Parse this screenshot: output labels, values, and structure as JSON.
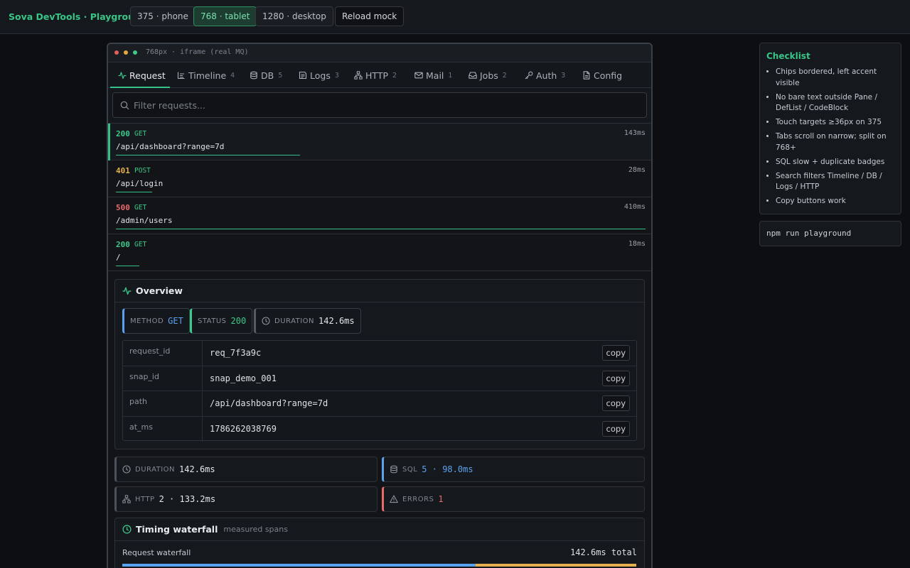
{
  "app": {
    "title": "Sova DevTools · Playground"
  },
  "viewports": [
    {
      "label": "375 · phone",
      "active": false
    },
    {
      "label": "768 · tablet",
      "active": true
    },
    {
      "label": "1280 · desktop",
      "active": false
    }
  ],
  "reload_label": "Reload mock",
  "device": {
    "label": "768px · iframe (real MQ)"
  },
  "tabs": [
    {
      "label": "Request",
      "count": "",
      "icon": "activity-icon",
      "active": true
    },
    {
      "label": "Timeline",
      "count": "4",
      "icon": "timeline-icon"
    },
    {
      "label": "DB",
      "count": "5",
      "icon": "database-icon"
    },
    {
      "label": "Logs",
      "count": "3",
      "icon": "logs-icon"
    },
    {
      "label": "HTTP",
      "count": "2",
      "icon": "network-icon"
    },
    {
      "label": "Mail",
      "count": "1",
      "icon": "mail-icon"
    },
    {
      "label": "Jobs",
      "count": "2",
      "icon": "inbox-icon"
    },
    {
      "label": "Auth",
      "count": "3",
      "icon": "key-icon"
    },
    {
      "label": "Config",
      "count": "",
      "icon": "file-icon"
    }
  ],
  "search": {
    "placeholder": "Filter requests..."
  },
  "requests": [
    {
      "status": "200",
      "method": "GET",
      "path": "/api/dashboard?range=7d",
      "duration": "143ms",
      "selected": true
    },
    {
      "status": "401",
      "method": "POST",
      "path": "/api/login",
      "duration": "28ms"
    },
    {
      "status": "500",
      "method": "GET",
      "path": "/admin/users",
      "duration": "410ms"
    },
    {
      "status": "200",
      "method": "GET",
      "path": "/",
      "duration": "18ms"
    }
  ],
  "overview": {
    "title": "Overview",
    "chips": [
      {
        "key": "METHOD",
        "value": "GET"
      },
      {
        "key": "STATUS",
        "value": "200"
      },
      {
        "key": "DURATION",
        "value": "142.6ms"
      }
    ],
    "fields": [
      {
        "key": "request_id",
        "value": "req_7f3a9c"
      },
      {
        "key": "snap_id",
        "value": "snap_demo_001"
      },
      {
        "key": "path",
        "value": "/api/dashboard?range=7d"
      },
      {
        "key": "at_ms",
        "value": "1786262038769"
      }
    ],
    "copy_label": "copy"
  },
  "stats": [
    {
      "key": "DURATION",
      "value": "142.6ms"
    },
    {
      "key": "SQL",
      "value": "5 · 98.0ms"
    },
    {
      "key": "HTTP",
      "value": "2 · 133.2ms"
    },
    {
      "key": "ERRORS",
      "value": "1"
    }
  ],
  "waterfall": {
    "title": "Timing waterfall",
    "subtitle": "measured spans",
    "label": "Request waterfall",
    "total": "142.6ms total"
  },
  "checklist": {
    "title": "Checklist",
    "items": [
      "Chips bordered, left accent visible",
      "No bare text outside Pane / DefList / CodeBlock",
      "Touch targets ≥36px on 375",
      "Tabs scroll on narrow; split on 768+",
      "SQL slow + duplicate badges",
      "Search filters Timeline / DB / Logs / HTTP",
      "Copy buttons work"
    ]
  },
  "command": "npm run playground",
  "colors": {
    "accent": "#34c185",
    "status_ok": "#3cc98a",
    "status_warn": "#e3b04b",
    "status_error": "#e86b6b",
    "info": "#5aa2ef"
  }
}
